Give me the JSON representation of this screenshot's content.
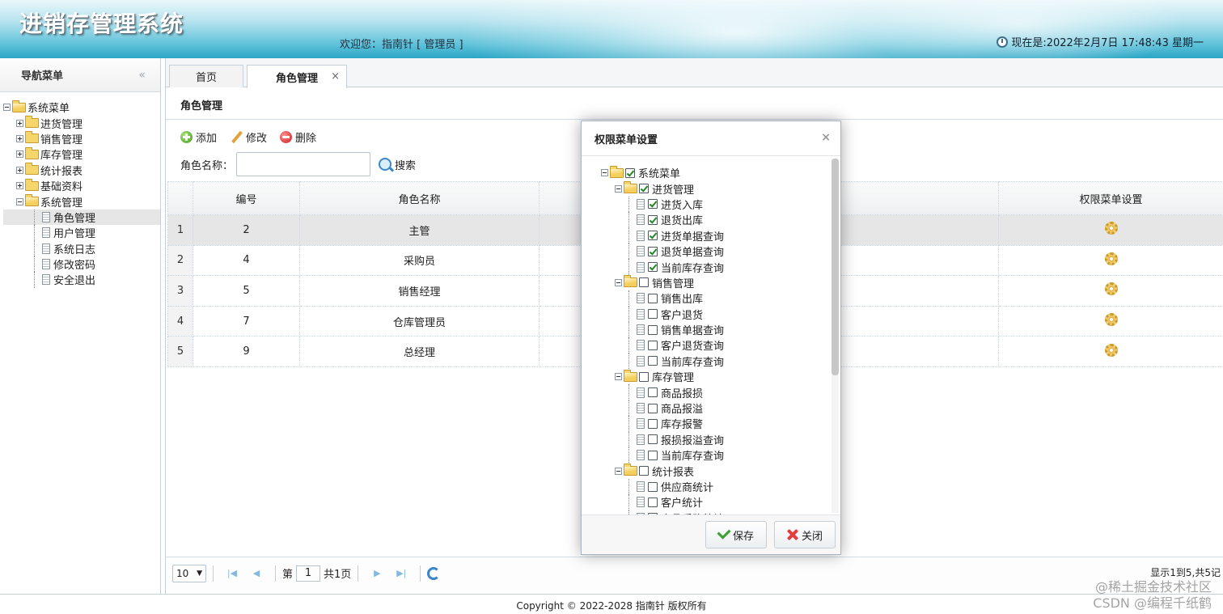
{
  "header": {
    "title": "进销存管理系统",
    "welcome": "欢迎您：指南针 [ 管理员 ]",
    "clock_text": "现在是:2022年2月7日 17:48:43 星期一"
  },
  "nav": {
    "title": "导航菜单",
    "collapse_glyph": "«",
    "root": "系统菜单",
    "groups": [
      "进货管理",
      "销售管理",
      "库存管理",
      "统计报表",
      "基础资料",
      "系统管理"
    ],
    "system_items": [
      "角色管理",
      "用户管理",
      "系统日志",
      "修改密码",
      "安全退出"
    ]
  },
  "tabs": [
    {
      "label": "首页",
      "active": false
    },
    {
      "label": "角色管理",
      "active": true,
      "close_glyph": "×"
    }
  ],
  "panel": {
    "title": "角色管理",
    "toolbar": {
      "add": "添加",
      "edit": "修改",
      "delete": "删除"
    },
    "search": {
      "label": "角色名称：",
      "value": "",
      "button": "搜索"
    }
  },
  "table": {
    "headers": [
      "",
      "编号",
      "角色名称",
      "",
      "权限菜单设置"
    ],
    "rows": [
      {
        "rn": "1",
        "id": "2",
        "name": "主管"
      },
      {
        "rn": "2",
        "id": "4",
        "name": "采购员"
      },
      {
        "rn": "3",
        "id": "5",
        "name": "销售经理"
      },
      {
        "rn": "4",
        "id": "7",
        "name": "仓库管理员"
      },
      {
        "rn": "5",
        "id": "9",
        "name": "总经理"
      }
    ],
    "highlighted_row": 1
  },
  "pager": {
    "page_size": "10",
    "page_prefix": "第",
    "page_value": "1",
    "page_suffix": "共1页",
    "info": "显示1到5,共5记"
  },
  "footer": {
    "copyright": "Copyright © 2022-2028 指南针 版权所有"
  },
  "watermark": {
    "line1": "@稀土掘金技术社区",
    "line2": "CSDN @编程千纸鹤"
  },
  "dialog": {
    "title": "权限菜单设置",
    "close_glyph": "×",
    "tree": [
      {
        "level": 0,
        "type": "folder",
        "label": "系统菜单",
        "checked": true
      },
      {
        "level": 1,
        "type": "folder",
        "label": "进货管理",
        "checked": true
      },
      {
        "level": 2,
        "type": "file",
        "label": "进货入库",
        "checked": true
      },
      {
        "level": 2,
        "type": "file",
        "label": "退货出库",
        "checked": true
      },
      {
        "level": 2,
        "type": "file",
        "label": "进货单据查询",
        "checked": true
      },
      {
        "level": 2,
        "type": "file",
        "label": "退货单据查询",
        "checked": true
      },
      {
        "level": 2,
        "type": "file",
        "label": "当前库存查询",
        "checked": true
      },
      {
        "level": 1,
        "type": "folder",
        "label": "销售管理",
        "checked": false
      },
      {
        "level": 2,
        "type": "file",
        "label": "销售出库",
        "checked": false
      },
      {
        "level": 2,
        "type": "file",
        "label": "客户退货",
        "checked": false
      },
      {
        "level": 2,
        "type": "file",
        "label": "销售单据查询",
        "checked": false
      },
      {
        "level": 2,
        "type": "file",
        "label": "客户退货查询",
        "checked": false
      },
      {
        "level": 2,
        "type": "file",
        "label": "当前库存查询",
        "checked": false
      },
      {
        "level": 1,
        "type": "folder",
        "label": "库存管理",
        "checked": false
      },
      {
        "level": 2,
        "type": "file",
        "label": "商品报损",
        "checked": false
      },
      {
        "level": 2,
        "type": "file",
        "label": "商品报溢",
        "checked": false
      },
      {
        "level": 2,
        "type": "file",
        "label": "库存报警",
        "checked": false
      },
      {
        "level": 2,
        "type": "file",
        "label": "报损报溢查询",
        "checked": false
      },
      {
        "level": 2,
        "type": "file",
        "label": "当前库存查询",
        "checked": false
      },
      {
        "level": 1,
        "type": "folder",
        "label": "统计报表",
        "checked": false
      },
      {
        "level": 2,
        "type": "file",
        "label": "供应商统计",
        "checked": false
      },
      {
        "level": 2,
        "type": "file",
        "label": "客户统计",
        "checked": false
      },
      {
        "level": 2,
        "type": "file",
        "label": "商品采购统计",
        "checked": false
      }
    ],
    "save_label": "保存",
    "close_label": "关闭"
  },
  "colors": {
    "header_accent": "#2aa6c6",
    "check_green": "#1f8a24"
  }
}
